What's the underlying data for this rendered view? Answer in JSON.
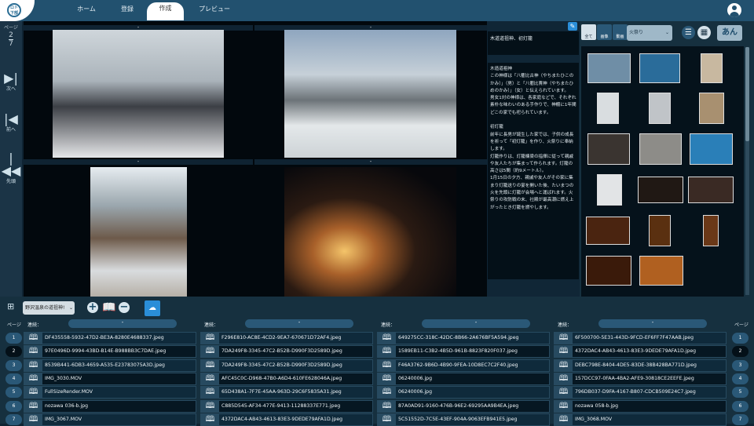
{
  "header": {
    "logo_text": "ロト下部",
    "nav": [
      "ホーム",
      "登録",
      "作成",
      "プレビュー"
    ],
    "active": "作成"
  },
  "sidebar": {
    "page_label": "ページ",
    "current": "2",
    "total": "7",
    "next": "次へ",
    "prev": "前へ",
    "first": "先頭"
  },
  "grid": {
    "cell_bar": "-"
  },
  "text_panel": {
    "title": "木道道祖神、初灯籠",
    "description": "木造道祖神\nこの神様は「八衢比古神（やちまたひこのかみ）」（男）と「八衢比賣神（やちまたひめのかみ）」（女）と伝えられています。\n男女1対の神様は、各家庭などで、それぞれ素朴な味わいのある手作りで、神棚に1年間どこの家でも祀られています。\n\n初灯籠\n前年に長男が誕生した家では、子供の成長を祈って「初灯籠」を作り、火祭りに奉納します。\n灯籠作りは、灯籠棟梁の指揮に従って親戚や友人たちが集まって作られます。灯籠の高さは5間（約9メートル）。\n1月15日の夕方、親戚や友人がその家に集まり灯籠送りの宴を開いた後、たいまつの火を先頭に灯籠が会場へと運ばれます。火祭りの攻防戦の末、社殿が最高潮に燃え上がったとき灯籠を燃やします。"
  },
  "media": {
    "filter_all": "全て",
    "filter_image": "画像",
    "filter_video": "動画",
    "category": "火祭り",
    "kana_button": "あん"
  },
  "bottom": {
    "album_select": "野沢温泉の道祖神!",
    "page_label": "ページ",
    "renzoku": "連続：",
    "bar": "-",
    "columns": [
      [
        "DF435558-5932-47D2-BE3A-8280E4688337.jpeg",
        "97E0496D-9994-43BD-B14E-B988BB3C7DAE.jpeg",
        "8539B441-6DB3-4659-A535-E23783075A3D.jpeg",
        "IMG_3030.MOV",
        "FullSizeRender.MOV",
        "nozawa 036-b.jpg",
        "IMG_3067.MOV"
      ],
      [
        "F296E810-AC8E-4CD2-9EA7-670671D72AF4.jpeg",
        "7DA249F8-3345-47C2-B52B-D990F3D2589D.jpeg",
        "7DA249F8-3345-47C2-B52B-D990F3D2589D.jpeg",
        "AFC45C0C-D968-47B0-A6D4-610FE628046A.jpeg",
        "65D438A1-7F7E-45AA-963D-29C6F5835A31.jpeg",
        "C885D545-AF34-477E-9413-11288337E771.jpeg",
        "4372DAC4-AB43-4613-83E3-9DEDE79AFA1D.jpeg"
      ],
      [
        "649275CC-318C-42DC-8B66-2A676BF5A594.jpeg",
        "1589EB11-C3B2-4B5D-961B-8823F820F037.jpeg",
        "F46A3762-9B6D-4B90-9FEA-10D8EC7C2F40.jpeg",
        "06240006.jpg",
        "06240006.jpg",
        "87A0AD91-9160-476B-96E2-69295AA9B4EA.jpeg",
        "5C51552D-7C5E-43EF-904A-9063EFB941E5.jpeg"
      ],
      [
        "6F500700-5E31-443D-9FCD-EF6FF7F47AAB.jpeg",
        "4372DAC4-AB43-4613-83E3-9DEDE79AFA1D.jpeg",
        "DEBC798E-8404-4DE5-83DE-38B428BA771D.jpeg",
        "157DCC97-0FAA-4BA2-AFE9-30818CE2EEFE.jpeg",
        "796DB037-D9FA-4167-B807-CDCB509E24C7.jpeg",
        "nozawa 058-b.jpg",
        "IMG_3068.MOV"
      ]
    ],
    "pages": [
      "1",
      "2",
      "3",
      "4",
      "5",
      "6",
      "7"
    ],
    "current_page": "2"
  },
  "colors": {
    "header": "#22516f",
    "accent": "#2a8ed8",
    "panel": "#16303f"
  }
}
